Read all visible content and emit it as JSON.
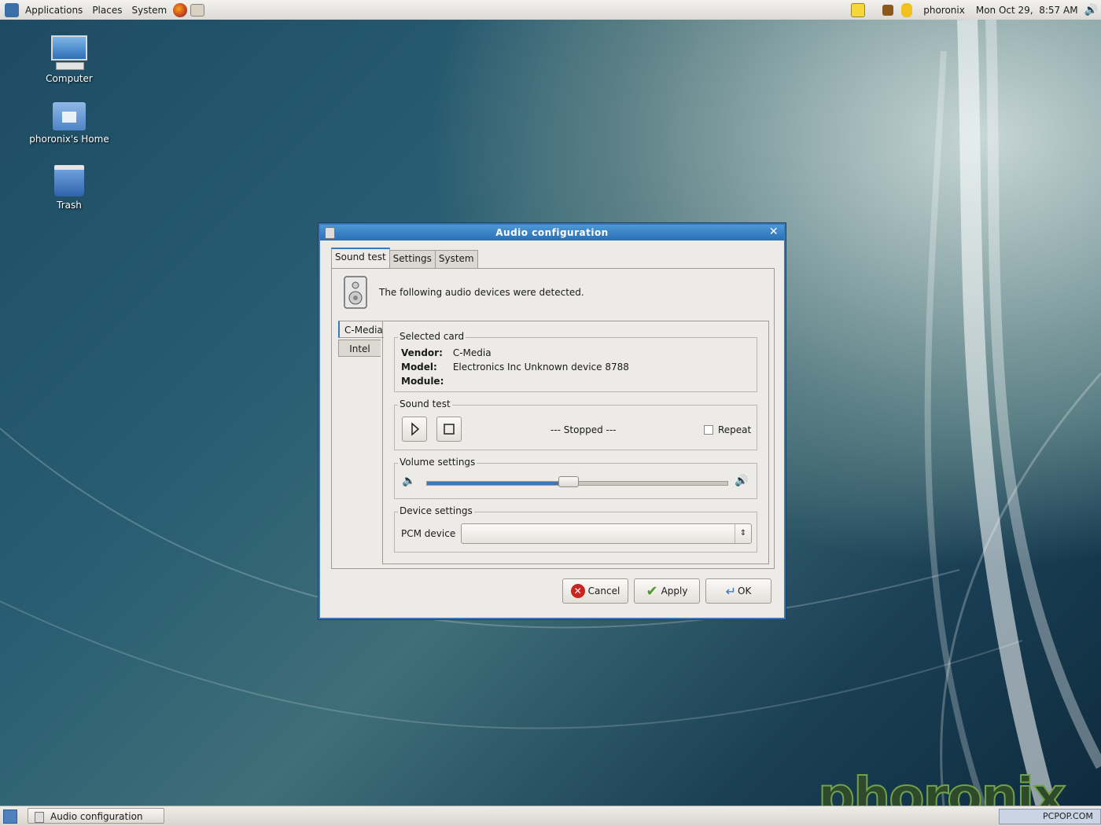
{
  "top_panel": {
    "menus": [
      "Applications",
      "Places",
      "System"
    ],
    "user": "phoronix",
    "clock": "Mon Oct 29,  8:57 AM",
    "icons": [
      "foot-icon",
      "firefox-icon",
      "email-icon",
      "notes-icon",
      "package-icon",
      "update-icon",
      "volume-icon"
    ]
  },
  "desktop_icons": [
    {
      "label": "Computer",
      "icon": "computer-icon"
    },
    {
      "label": "phoronix's Home",
      "icon": "home-folder-icon"
    },
    {
      "label": "Trash",
      "icon": "trash-icon"
    }
  ],
  "dialog": {
    "title": "Audio configuration",
    "tabs": [
      "Sound test",
      "Settings",
      "System"
    ],
    "active_tab": "Sound test",
    "intro": "The following audio devices were detected.",
    "devices": [
      "C-Media",
      "Intel"
    ],
    "selected_device": "C-Media",
    "selected_card": {
      "legend": "Selected card",
      "vendor_label": "Vendor:",
      "vendor": "C-Media",
      "model_label": "Model:",
      "model": "Electronics Inc Unknown device 8788",
      "module_label": "Module:",
      "module": ""
    },
    "sound_test": {
      "legend": "Sound test",
      "status": "--- Stopped ---",
      "repeat_label": "Repeat",
      "repeat_checked": false
    },
    "volume": {
      "legend": "Volume settings",
      "level_percent": 47
    },
    "device_settings": {
      "legend": "Device settings",
      "pcm_label": "PCM device",
      "pcm_value": ""
    },
    "buttons": {
      "cancel": "Cancel",
      "apply": "Apply",
      "ok": "OK"
    }
  },
  "taskbar": {
    "window": "Audio configuration"
  },
  "watermark": "phoronix",
  "corner_text": "PCPOP.COM",
  "colors": {
    "accent": "#3a78b8",
    "title_bar": "#2a6fb4",
    "cancel_red": "#c8251e",
    "apply_green": "#4c9a2a"
  }
}
